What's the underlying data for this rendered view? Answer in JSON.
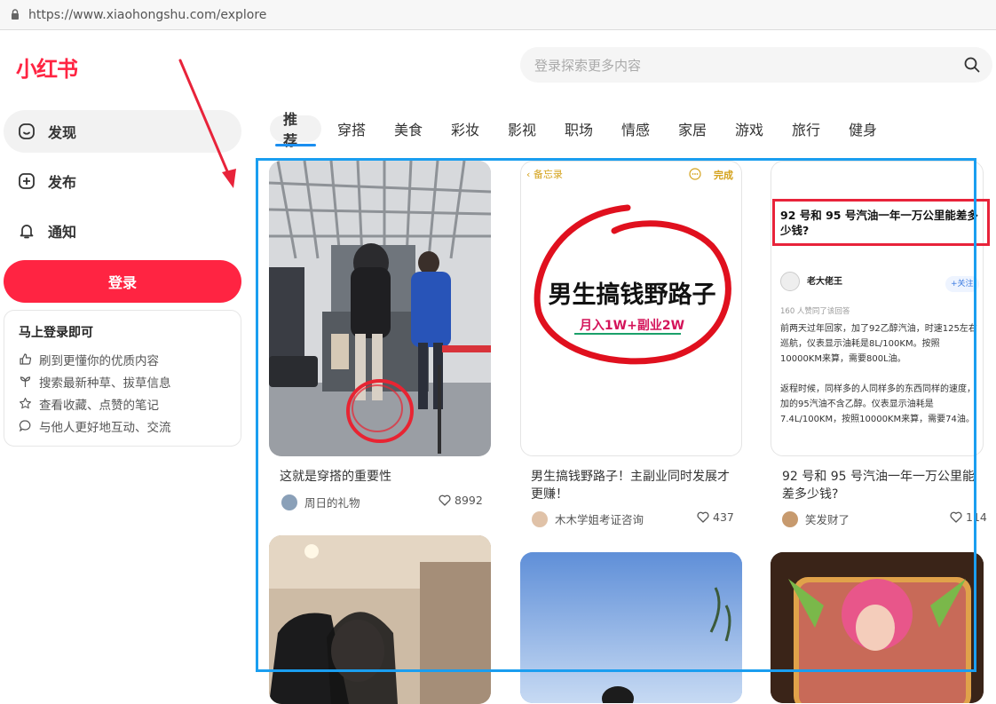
{
  "browser": {
    "url": "https://www.xiaohongshu.com/explore"
  },
  "app": {
    "logo": "小红书",
    "accent": "#ff2442"
  },
  "search": {
    "placeholder": "登录探索更多内容"
  },
  "sidebar": {
    "items": [
      {
        "label": "发现",
        "icon": "home-icon"
      },
      {
        "label": "发布",
        "icon": "plus-square-icon"
      },
      {
        "label": "通知",
        "icon": "bell-icon"
      }
    ],
    "login_label": "登录",
    "promo": {
      "title": "马上登录即可",
      "rows": [
        {
          "icon": "thumb-icon",
          "text": "刷到更懂你的优质内容"
        },
        {
          "icon": "sprout-icon",
          "text": "搜索最新种草、拔草信息"
        },
        {
          "icon": "star-icon",
          "text": "查看收藏、点赞的笔记"
        },
        {
          "icon": "chat-icon",
          "text": "与他人更好地互动、交流"
        }
      ]
    }
  },
  "tabs": [
    "推荐",
    "穿搭",
    "美食",
    "彩妆",
    "影视",
    "职场",
    "情感",
    "家居",
    "游戏",
    "旅行",
    "健身"
  ],
  "feed": [
    {
      "title": "这就是穿搭的重要性",
      "author": "周日的礼物",
      "likes": "8992"
    },
    {
      "title": "男生搞钱野路子！主副业同时发展才更赚！",
      "author": "木木学姐考证咨询",
      "likes": "437",
      "cover": {
        "top_left": "备忘录",
        "top_right": "完成",
        "headline": "男生搞钱野路子",
        "subline": "月入1W+副业2W"
      }
    },
    {
      "title": "92 号和 95 号汽油一年一万公里能差多少钱?",
      "author": "笑发财了",
      "likes": "114",
      "cover": {
        "heading": "92 号和 95 号汽油一年一万公里能差多少钱?",
        "author": "老大佬王",
        "follow": "+关注",
        "meta": "160 人赞同了该回答",
        "para1": "前两天过年回家，加了92乙醇汽油，时速125左右巡航，仪表显示油耗是8L/100KM。按照10000KM来算，需要800L油。",
        "para2": "返程时候，同样多的人同样多的东西同样的速度，加的95汽油不含乙醇。仪表显示油耗是7.4L/100KM，按照10000KM来算，需要74油。"
      }
    }
  ]
}
